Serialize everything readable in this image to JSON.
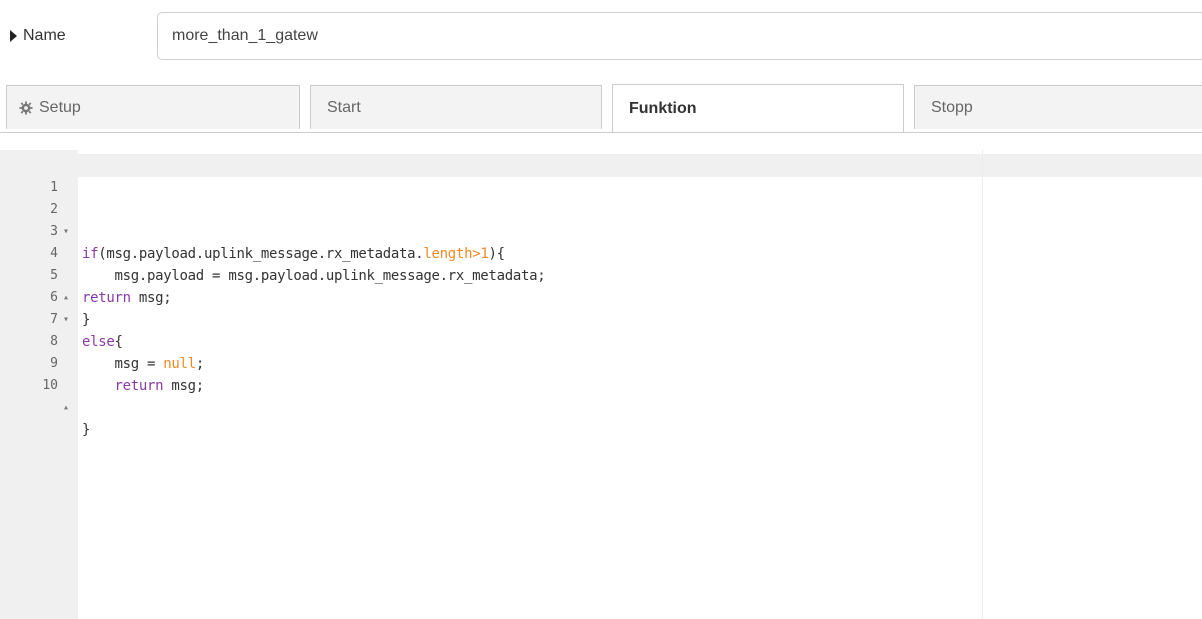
{
  "name_field": {
    "label": "Name",
    "value": "more_than_1_gatew"
  },
  "tabs": [
    {
      "label": "Setup",
      "icon": "gear-icon",
      "active": false
    },
    {
      "label": "Start",
      "active": false
    },
    {
      "label": "Funktion",
      "active": true
    },
    {
      "label": "Stopp",
      "active": false
    }
  ],
  "editor": {
    "lines": [
      {
        "number": "1",
        "fold": ""
      },
      {
        "number": "2",
        "fold": "▾"
      },
      {
        "number": "3",
        "fold": ""
      },
      {
        "number": "4",
        "fold": ""
      },
      {
        "number": "5",
        "fold": "▴"
      },
      {
        "number": "6",
        "fold": "▾"
      },
      {
        "number": "7",
        "fold": ""
      },
      {
        "number": "8",
        "fold": ""
      },
      {
        "number": "9",
        "fold": ""
      },
      {
        "number": "10",
        "fold": "▴"
      }
    ],
    "code": {
      "l2_kw": "if",
      "l2_a": "(msg.payload.uplink_message.rx_metadata.",
      "l2_len": "length",
      "l2_gt": ">",
      "l2_num": "1",
      "l2_b": "){",
      "l3": "    msg.payload = msg.payload.uplink_message.rx_metadata;",
      "l4_kw": "return",
      "l4_rest": " msg;",
      "l5": "}",
      "l6_kw": "else",
      "l6_rest": "{",
      "l7_a": "    msg = ",
      "l7_null": "null",
      "l7_b": ";",
      "l8_indent": "    ",
      "l8_kw": "return",
      "l8_rest": " msg;",
      "l10": "}"
    }
  }
}
